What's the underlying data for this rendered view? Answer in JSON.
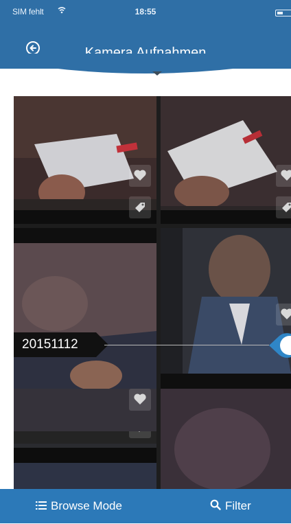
{
  "status_bar": {
    "carrier": "SIM fehlt",
    "time": "18:55"
  },
  "header": {
    "title": "Kamera Aufnahmen"
  },
  "scrubber": {
    "date_label": "20151112"
  },
  "toolbar": {
    "browse_label": "Browse Mode",
    "filter_label": "Filter"
  },
  "icons": [
    "back-icon",
    "wifi-icon",
    "battery-icon",
    "heart-icon",
    "tag-icon",
    "list-icon",
    "search-icon",
    "chevron-down-icon"
  ],
  "colors": {
    "header_blue": "#2f6fa6",
    "toolbar_blue": "#2c79b8",
    "scrub_handle": "#2f86c7"
  }
}
